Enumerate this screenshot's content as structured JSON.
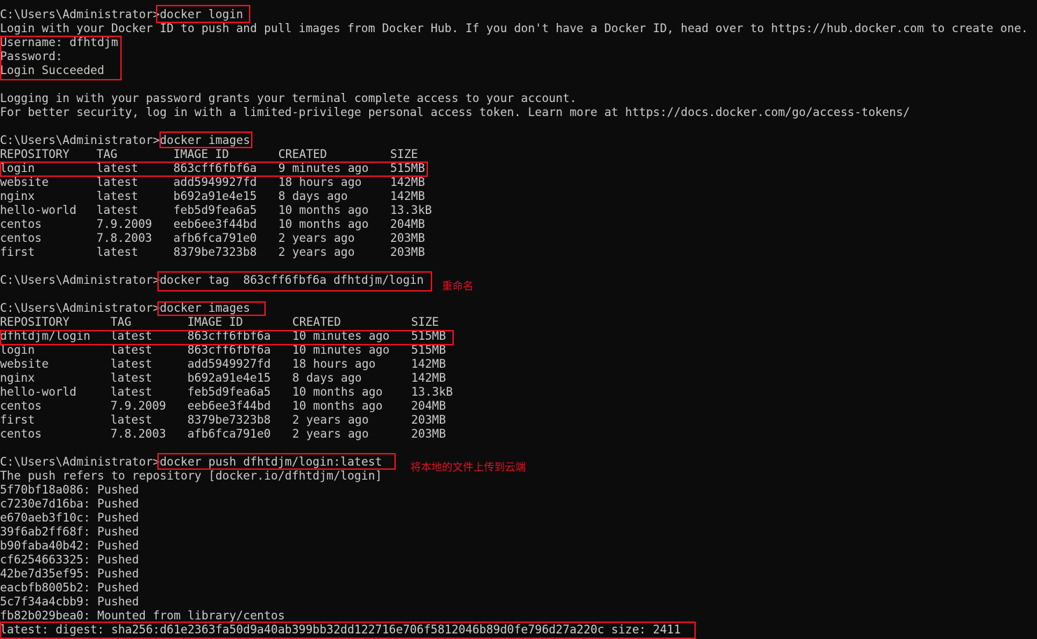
{
  "terminal": {
    "prompt": "C:\\Users\\Administrator>",
    "lines": [
      {
        "prompt": "C:\\Users\\Administrator>",
        "cmd": "docker login"
      },
      {
        "text": "Login with your Docker ID to push and pull images from Docker Hub. If you don't have a Docker ID, head over to https://hub.docker.com to create one."
      },
      {
        "text": "Username: dfhtdjm"
      },
      {
        "text": "Password:"
      },
      {
        "text": "Login Succeeded"
      },
      {
        "text": ""
      },
      {
        "text": "Logging in with your password grants your terminal complete access to your account."
      },
      {
        "text": "For better security, log in with a limited-privilege personal access token. Learn more at https://docs.docker.com/go/access-tokens/"
      },
      {
        "text": ""
      },
      {
        "prompt": "C:\\Users\\Administrator>",
        "cmd": "docker images"
      },
      {
        "table": 1,
        "cells": [
          "REPOSITORY",
          "TAG",
          "IMAGE ID",
          "CREATED",
          "SIZE"
        ]
      },
      {
        "table": 1,
        "cells": [
          "login",
          "latest",
          "863cff6fbf6a",
          "9 minutes ago",
          "515MB"
        ]
      },
      {
        "table": 1,
        "cells": [
          "website",
          "latest",
          "add5949927fd",
          "18 hours ago",
          "142MB"
        ]
      },
      {
        "table": 1,
        "cells": [
          "nginx",
          "latest",
          "b692a91e4e15",
          "8 days ago",
          "142MB"
        ]
      },
      {
        "table": 1,
        "cells": [
          "hello-world",
          "latest",
          "feb5d9fea6a5",
          "10 months ago",
          "13.3kB"
        ]
      },
      {
        "table": 1,
        "cells": [
          "centos",
          "7.9.2009",
          "eeb6ee3f44bd",
          "10 months ago",
          "204MB"
        ]
      },
      {
        "table": 1,
        "cells": [
          "centos",
          "7.8.2003",
          "afb6fca791e0",
          "2 years ago",
          "203MB"
        ]
      },
      {
        "table": 1,
        "cells": [
          "first",
          "latest",
          "8379be7323b8",
          "2 years ago",
          "203MB"
        ]
      },
      {
        "text": ""
      },
      {
        "prompt": "C:\\Users\\Administrator>",
        "cmd": "docker tag  863cff6fbf6a dfhtdjm/login"
      },
      {
        "text": ""
      },
      {
        "prompt": "C:\\Users\\Administrator>",
        "cmd": "docker images"
      },
      {
        "table": 2,
        "cells": [
          "REPOSITORY",
          "TAG",
          "IMAGE ID",
          "CREATED",
          "SIZE"
        ]
      },
      {
        "table": 2,
        "cells": [
          "dfhtdjm/login",
          "latest",
          "863cff6fbf6a",
          "10 minutes ago",
          "515MB"
        ]
      },
      {
        "table": 2,
        "cells": [
          "login",
          "latest",
          "863cff6fbf6a",
          "10 minutes ago",
          "515MB"
        ]
      },
      {
        "table": 2,
        "cells": [
          "website",
          "latest",
          "add5949927fd",
          "18 hours ago",
          "142MB"
        ]
      },
      {
        "table": 2,
        "cells": [
          "nginx",
          "latest",
          "b692a91e4e15",
          "8 days ago",
          "142MB"
        ]
      },
      {
        "table": 2,
        "cells": [
          "hello-world",
          "latest",
          "feb5d9fea6a5",
          "10 months ago",
          "13.3kB"
        ]
      },
      {
        "table": 2,
        "cells": [
          "centos",
          "7.9.2009",
          "eeb6ee3f44bd",
          "10 months ago",
          "204MB"
        ]
      },
      {
        "table": 2,
        "cells": [
          "first",
          "latest",
          "8379be7323b8",
          "2 years ago",
          "203MB"
        ]
      },
      {
        "table": 2,
        "cells": [
          "centos",
          "7.8.2003",
          "afb6fca791e0",
          "2 years ago",
          "203MB"
        ]
      },
      {
        "text": ""
      },
      {
        "prompt": "C:\\Users\\Administrator>",
        "cmd": "docker push dfhtdjm/login:latest"
      },
      {
        "text": "The push refers to repository [docker.io/dfhtdjm/login]"
      },
      {
        "text": "5f70bf18a086: Pushed"
      },
      {
        "text": "c7230e7d16ba: Pushed"
      },
      {
        "text": "e670aeb3f10c: Pushed"
      },
      {
        "text": "39f6ab2ff68f: Pushed"
      },
      {
        "text": "b90faba40b42: Pushed"
      },
      {
        "text": "cf6254663325: Pushed"
      },
      {
        "text": "42be7d35ef95: Pushed"
      },
      {
        "text": "eacbfb8005b2: Pushed"
      },
      {
        "text": "5c7f34a4cbb9: Pushed"
      },
      {
        "text": "fb82b029bea0: Mounted from library/centos"
      },
      {
        "text": "latest: digest: sha256:d61e2363fa50d9a40ab399bb32dd122716e706f5812046b89d0fe796d27a220c size: 2411"
      }
    ]
  },
  "annotations": {
    "rename_note": "重命名",
    "upload_note": "将本地的文件上传到云端"
  },
  "colors": {
    "background": "#0c0c0c",
    "text": "#cccccc",
    "annotation": "#e81123"
  }
}
